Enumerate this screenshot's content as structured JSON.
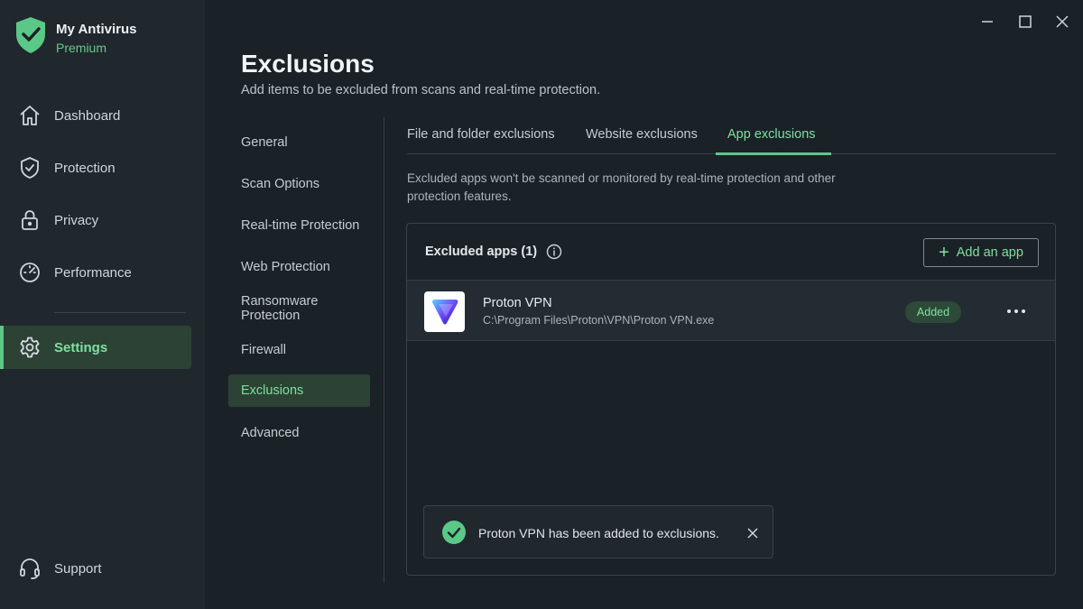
{
  "brand": {
    "name": "My Antivirus",
    "tier": "Premium"
  },
  "sidebar": {
    "items": [
      {
        "label": "Dashboard",
        "icon": "home-icon"
      },
      {
        "label": "Protection",
        "icon": "shield-icon"
      },
      {
        "label": "Privacy",
        "icon": "lock-icon"
      },
      {
        "label": "Performance",
        "icon": "speedometer-icon"
      },
      {
        "label": "Settings",
        "icon": "gear-icon",
        "active": true
      }
    ],
    "support": {
      "label": "Support",
      "icon": "headset-icon"
    }
  },
  "header": {
    "title": "Exclusions",
    "subtitle": "Add items to be excluded from scans and real-time protection."
  },
  "settings_nav": {
    "items": [
      {
        "label": "General"
      },
      {
        "label": "Scan Options"
      },
      {
        "label": "Real-time Protection"
      },
      {
        "label": "Web Protection"
      },
      {
        "label": "Ransomware Protection"
      },
      {
        "label": "Firewall"
      },
      {
        "label": "Exclusions",
        "active": true
      },
      {
        "label": "Advanced"
      }
    ]
  },
  "tabs": [
    {
      "label": "File and folder exclusions"
    },
    {
      "label": "Website exclusions"
    },
    {
      "label": "App exclusions",
      "active": true
    }
  ],
  "description": "Excluded apps won't be scanned or monitored by real-time protection and other protection features.",
  "panel": {
    "title": "Excluded apps (1)",
    "add_button": "Add an app",
    "apps": [
      {
        "name": "Proton VPN",
        "path": "C:\\Program Files\\Proton\\VPN\\Proton VPN.exe",
        "status": "Added"
      }
    ]
  },
  "toast": {
    "message": "Proton VPN has been added to exclusions."
  },
  "colors": {
    "accent": "#5cc887",
    "accent_text": "#7ee0a0",
    "background": "#1b2227",
    "sidebar": "#20282e"
  }
}
